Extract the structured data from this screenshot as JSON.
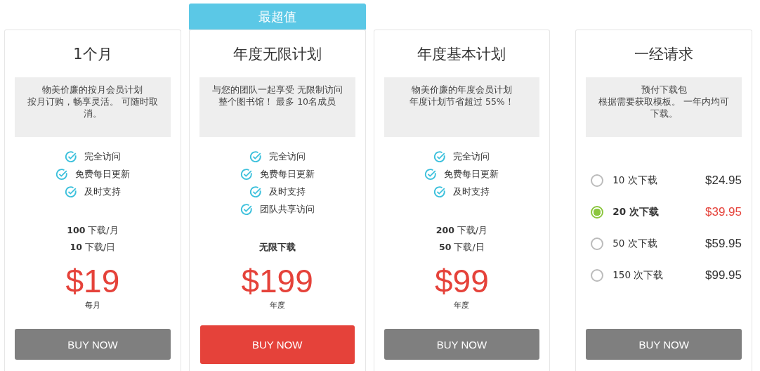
{
  "plans": [
    {
      "kind": "plan",
      "title": "1个月",
      "description": [
        "物美价廉的按月会员计划",
        "按月订购，畅享灵活。 可随时取消。"
      ],
      "features": [
        "完全访问",
        "免费每日更新",
        "及时支持"
      ],
      "limits": [
        "**100** 下载/月",
        "**10** 下载/日"
      ],
      "price": "$19",
      "period": "每月",
      "button": "BUY NOW",
      "featured": false
    },
    {
      "kind": "plan",
      "badge": "最超值",
      "title": "年度无限计划",
      "description": [
        "与您的团队一起享受 无限制访问",
        "整个图书馆！ 最多 10名成员"
      ],
      "features": [
        "完全访问",
        "免费每日更新",
        "及时支持",
        "团队共享访问"
      ],
      "limits": [
        "**无限下载**"
      ],
      "price": "$199",
      "period": "年度",
      "button": "BUY NOW",
      "featured": true
    },
    {
      "kind": "plan",
      "title": "年度基本计划",
      "description": [
        "物美价廉的年度会员计划",
        "年度计划节省超过 55%！"
      ],
      "features": [
        "完全访问",
        "免费每日更新",
        "及时支持"
      ],
      "limits": [
        "**200** 下载/月",
        "**50** 下载/日"
      ],
      "price": "$99",
      "period": "年度",
      "button": "BUY NOW",
      "featured": false
    },
    {
      "kind": "packs",
      "title": "一经请求",
      "description": [
        "预付下载包",
        "根据需要获取模板。 一年内均可下载。"
      ],
      "options": [
        {
          "label": "10 次下载",
          "price": "$24.95",
          "selected": false
        },
        {
          "label": "20 次下载",
          "price": "$39.95",
          "selected": true
        },
        {
          "label": "50 次下载",
          "price": "$59.95",
          "selected": false
        },
        {
          "label": "150 次下载",
          "price": "$99.95",
          "selected": false
        }
      ],
      "button": "BUY NOW",
      "featured": false
    }
  ]
}
